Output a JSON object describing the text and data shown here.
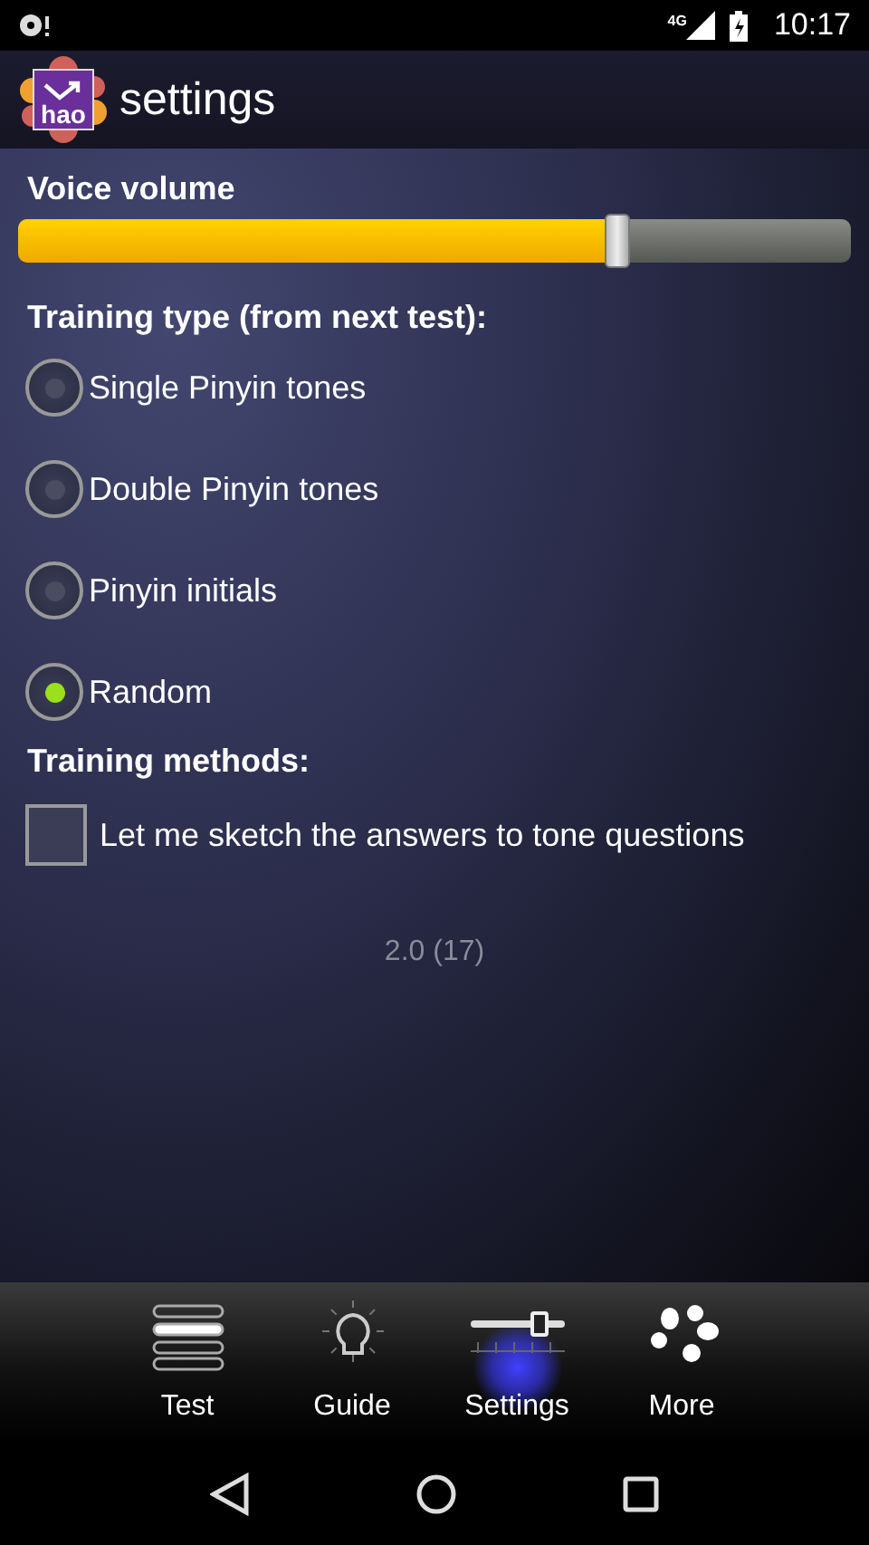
{
  "status_bar": {
    "network": "4G",
    "time": "10:17"
  },
  "app_bar": {
    "logo_text": "hao",
    "title": "settings"
  },
  "volume": {
    "label": "Voice volume",
    "level": 0.72
  },
  "training_type": {
    "label": "Training type (from next test):",
    "options": [
      {
        "label": "Single Pinyin tones",
        "selected": false
      },
      {
        "label": "Double Pinyin tones",
        "selected": false
      },
      {
        "label": "Pinyin initials",
        "selected": false
      },
      {
        "label": "Random",
        "selected": true
      }
    ]
  },
  "training_methods": {
    "label": "Training methods:",
    "options": [
      {
        "label": "Let me sketch the answers to tone questions",
        "checked": false
      }
    ]
  },
  "version": "2.0 (17)",
  "tabs": [
    {
      "label": "Test",
      "kind": "list",
      "selected": false
    },
    {
      "label": "Guide",
      "kind": "bulb",
      "selected": false
    },
    {
      "label": "Settings",
      "kind": "slider",
      "selected": true
    },
    {
      "label": "More",
      "kind": "dots",
      "selected": false
    }
  ]
}
